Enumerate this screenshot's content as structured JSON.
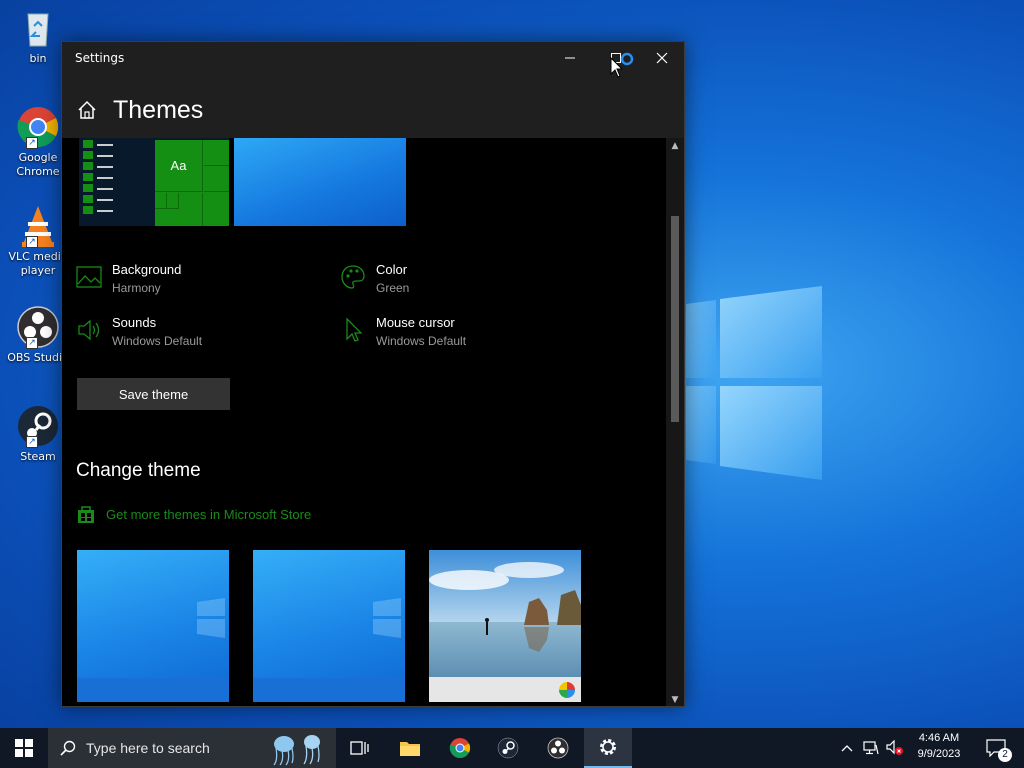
{
  "desktop": {
    "icons": [
      {
        "label": "bin",
        "icon": "recycle-bin-icon"
      },
      {
        "label": "Google Chrome",
        "icon": "chrome-icon"
      },
      {
        "label": "VLC media player",
        "icon": "vlc-icon"
      },
      {
        "label": "OBS Studio",
        "icon": "obs-icon"
      },
      {
        "label": "Steam",
        "icon": "steam-icon"
      }
    ]
  },
  "window": {
    "title": "Settings",
    "page_title": "Themes",
    "current_theme": {
      "background_label": "Background",
      "background_value": "Harmony",
      "color_label": "Color",
      "color_value": "Green",
      "sounds_label": "Sounds",
      "sounds_value": "Windows Default",
      "cursor_label": "Mouse cursor",
      "cursor_value": "Windows Default",
      "preview_tile_text": "Aa",
      "save_label": "Save theme"
    },
    "change_theme": {
      "title": "Change theme",
      "store_link": "Get more themes in Microsoft Store"
    },
    "accent_color": "#1a8a1a"
  },
  "taskbar": {
    "search_placeholder": "Type here to search",
    "time": "4:46 AM",
    "date": "9/9/2023",
    "notification_count": "2"
  }
}
